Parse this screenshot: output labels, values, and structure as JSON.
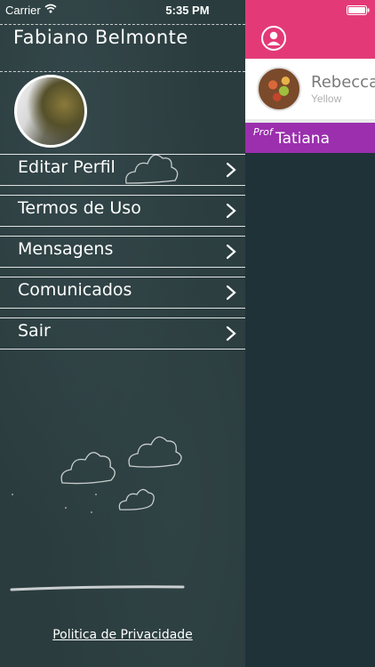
{
  "status_bar": {
    "carrier": "Carrier",
    "time": "5:35 PM"
  },
  "menu": {
    "user_name": "Fabiano Belmonte",
    "items": [
      {
        "label": "Editar Perfil",
        "icon": "chevron-right-icon"
      },
      {
        "label": "Termos de Uso",
        "icon": "chevron-right-icon"
      },
      {
        "label": "Mensagens",
        "icon": "chevron-right-icon"
      },
      {
        "label": "Comunicados",
        "icon": "chevron-right-icon"
      },
      {
        "label": "Sair",
        "icon": "chevron-right-icon"
      }
    ],
    "privacy_link": "Politica de Privacidade"
  },
  "content": {
    "header_icon": "person-icon",
    "person": {
      "name": "Rebecca R",
      "subtitle": "Yellow"
    },
    "teacher": {
      "prefix": "Prof",
      "name": "Tatiana"
    }
  },
  "colors": {
    "chalkboard": "#2a3c3e",
    "content_bg": "#1f3238",
    "header_pink": "#e33a77",
    "teacher_purple": "#9b2fae"
  }
}
